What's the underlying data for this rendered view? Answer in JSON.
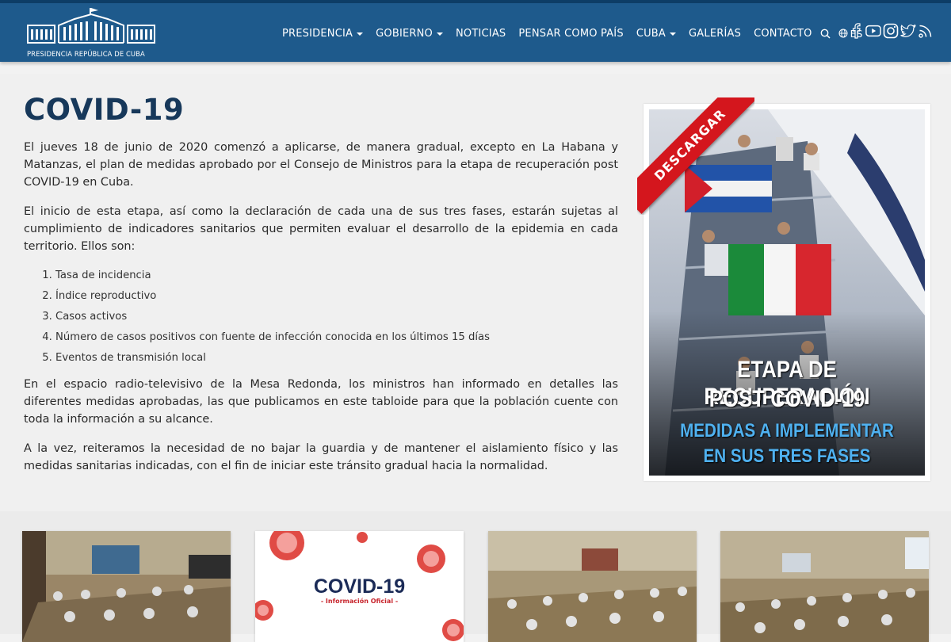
{
  "header": {
    "logo_text": "PRESIDENCIA REPÚBLICA DE CUBA",
    "nav": [
      {
        "label": "PRESIDENCIA",
        "dropdown": true
      },
      {
        "label": "GOBIERNO",
        "dropdown": true
      },
      {
        "label": "NOTICIAS",
        "dropdown": false
      },
      {
        "label": "PENSAR COMO PAÍS",
        "dropdown": false
      },
      {
        "label": "CUBA",
        "dropdown": true
      },
      {
        "label": "GALERÍAS",
        "dropdown": false
      },
      {
        "label": "CONTACTO",
        "dropdown": false
      }
    ],
    "search_icon": "search-icon",
    "language": "ES",
    "language_icon": "globe-icon",
    "social_icons": [
      "facebook-icon",
      "youtube-icon",
      "instagram-icon",
      "twitter-icon",
      "rss-icon"
    ],
    "bar_color": "#1e5a8c"
  },
  "main": {
    "title": "COVID-19",
    "paragraphs": [
      "El jueves 18 de junio de 2020 comenzó a aplicarse, de manera gradual, excepto en La Habana y Matanzas, el plan de medidas aprobado por el Consejo de Ministros para la etapa de recuperación post COVID-19 en Cuba.",
      "El inicio de esta etapa, así como la declaración de cada una de sus tres fases, estarán sujetas al cumplimiento de indicadores sanitarios que permiten evaluar el desarrollo de la epidemia en cada territorio. Ellos son:",
      "En el espacio radio-televisivo de la Mesa Redonda, los ministros han informado en detalles las diferentes medidas aprobadas, las que publicamos en este tabloide para que la población cuente con toda la información a su alcance.",
      "A la vez, reiteramos la necesidad de no bajar la guardia y de mantener el aislamiento físico y las medidas sanitarias indicadas, con el fin de iniciar este tránsito gradual hacia la normalidad."
    ],
    "indicators": [
      "Tasa de incidencia",
      " Índice reproductivo",
      "Casos activos",
      "Número de casos positivos con fuente de infección conocida en los últimos 15 días",
      "Eventos de transmisión local"
    ],
    "banner": {
      "ribbon": "DESCARGAR",
      "line1": "ETAPA DE RECUPERACIÓN",
      "line2": "POST COVID-19",
      "line3": "MEDIDAS A IMPLEMENTAR",
      "line4": "EN SUS TRES FASES"
    }
  },
  "cards": [
    {
      "type": "photo-meeting"
    },
    {
      "type": "covid-info",
      "title": "COVID-19",
      "subtitle": "- Información Oficial -"
    },
    {
      "type": "photo-meeting"
    },
    {
      "type": "photo-meeting"
    }
  ]
}
